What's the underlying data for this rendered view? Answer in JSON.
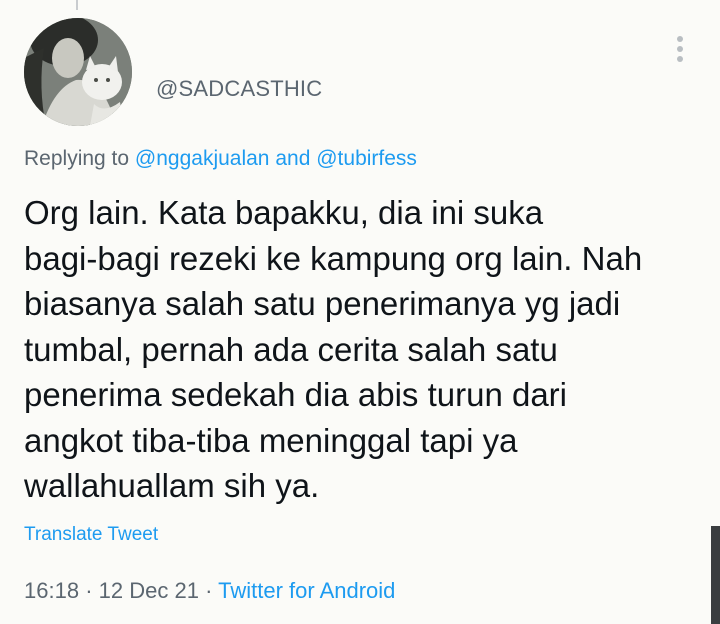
{
  "tweet": {
    "handle": "@SADCASTHIC",
    "replying": {
      "prefix": "Replying to",
      "user1": "@nggakjualan",
      "conjunction": "and",
      "user2": "@tubirfess"
    },
    "text_lines": [
      "Org lain. Kata bapakku, dia ini suka",
      "bagi-bagi rezeki ke kampung org lain. Nah",
      "biasanya salah satu penerimanya yg jadi",
      "tumbal, pernah ada cerita salah satu",
      "penerima sedekah dia abis turun dari",
      "angkot tiba-tiba meninggal tapi ya",
      "wallahuallam sih ya."
    ],
    "translate_label": "Translate Tweet",
    "time": "16:18",
    "date": "12 Dec 21",
    "separator": "·",
    "source": "Twitter for Android"
  },
  "colors": {
    "accent": "#1d9bf0",
    "secondary_text": "#5b6670",
    "primary_text": "#0f1419",
    "background": "#fbfbf8"
  },
  "icons": {
    "more": "more-vertical-icon"
  }
}
